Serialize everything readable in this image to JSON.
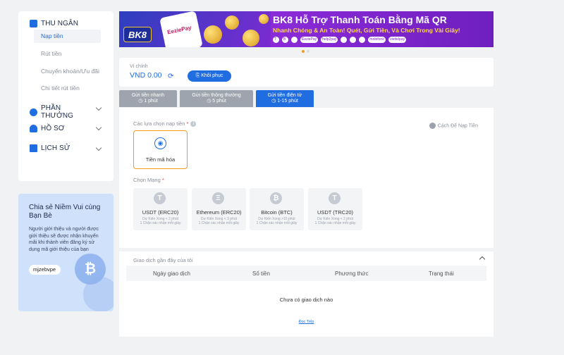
{
  "sidebar": {
    "cashier": {
      "label": "THU NGÂN",
      "items": [
        "Nạp tiền",
        "Rút tiền",
        "Chuyển khoản/Ưu đãi",
        "Chi tiết rút tiền"
      ]
    },
    "rewards": {
      "label": "PHẦN THƯỞNG"
    },
    "profile": {
      "label": "HỒ SƠ"
    },
    "history": {
      "label": "LỊCH SỬ"
    }
  },
  "share": {
    "title": "Chia sẻ Niềm Vui cùng Bạn Bè",
    "desc": "Người giới thiệu và người được giới thiệu sẽ được nhận khuyến mãi khi thành viên đăng ký sử dụng mã giới thiệu của bạn",
    "code": "mjzebvpe"
  },
  "banner": {
    "logo": "BK8",
    "ezpay": "EeziePay",
    "title": "BK8 Hỗ Trợ Thanh Toán Bằng Mã QR",
    "subtitle": "Nhanh Chóng & An Toàn! Quét, Gửi Tiền, Và Chơi Trong Vài Giây!",
    "logos": [
      "T",
      "B",
      "",
      "EeziePay",
      "help2pay",
      "",
      "",
      "",
      "mobifone",
      "viettelpay"
    ]
  },
  "wallet": {
    "label": "Ví chính",
    "amount": "VND 0.00",
    "restore": "Khôi phục"
  },
  "tabs": [
    {
      "label": "Gửi tiền nhanh",
      "time": "1 phút"
    },
    {
      "label": "Gửi tiền thông thường",
      "time": "5 phút"
    },
    {
      "label": "Gửi tiền điện tử",
      "time": "1-15 phút"
    }
  ],
  "deposit": {
    "options_label": "Các lựa chọn nạp tiền",
    "guide": "Cách Để Nạp Tiền",
    "method": "Tiền mã hóa",
    "network_label": "Chọn Mạng",
    "networks": [
      {
        "name": "USDT (ERC20)",
        "eta": "Dự Kiến Xong < 2 phút",
        "conf": "1 Chặn xác nhận mỗi giây",
        "icon": "T"
      },
      {
        "name": "Ethereum (ERC20)",
        "eta": "Dự Kiến Xong < 3 phút",
        "conf": "1 Chặn xác nhận mỗi giây",
        "icon": "Ξ"
      },
      {
        "name": "Bitcoin (BTC)",
        "eta": "Dự Kiến Xong >15 phút",
        "conf": "1 Chặn xác nhận mỗi giây",
        "icon": "₿"
      },
      {
        "name": "USDT (TRC20)",
        "eta": "Dự Kiến Xong < 2 phút",
        "conf": "1 Chặn xác nhận mỗi giây",
        "icon": "T"
      }
    ]
  },
  "transactions": {
    "title": "Giao dịch gần đây của tôi",
    "columns": [
      "Ngày giao dịch",
      "Số tiền",
      "Phương thức",
      "Trạng thái"
    ],
    "empty": "Chưa có giao dịch nào",
    "more": "Đọc Tiếp"
  },
  "colors": {
    "accent": "#1f6de0",
    "highlight": "#f29a1a",
    "banner": "#7d1fd0"
  }
}
